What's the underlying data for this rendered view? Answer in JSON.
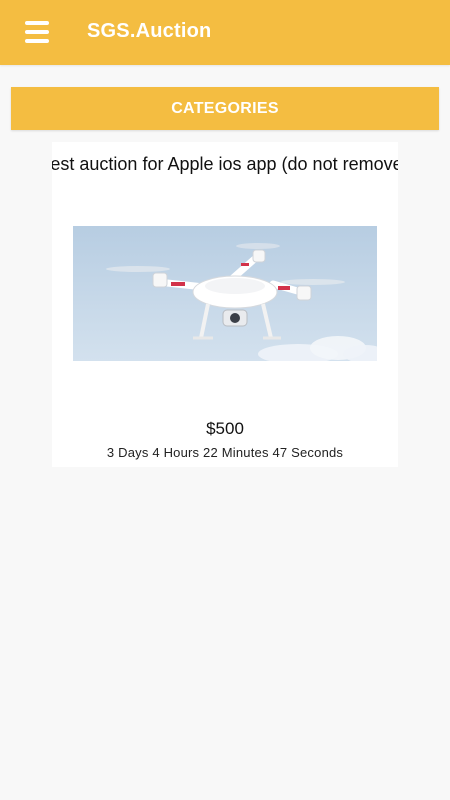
{
  "app_bar": {
    "title": "SGS.Auction",
    "menu_icon": "hamburger-menu-icon",
    "background_color": "#f4bd41"
  },
  "categories_button": {
    "label": "CATEGORIES"
  },
  "auction": {
    "title": "Test auction for Apple ios app (do not remove)",
    "image_subject": "drone",
    "price": "$500",
    "time_remaining": "3 Days 4 Hours 22 Minutes 47 Seconds"
  }
}
